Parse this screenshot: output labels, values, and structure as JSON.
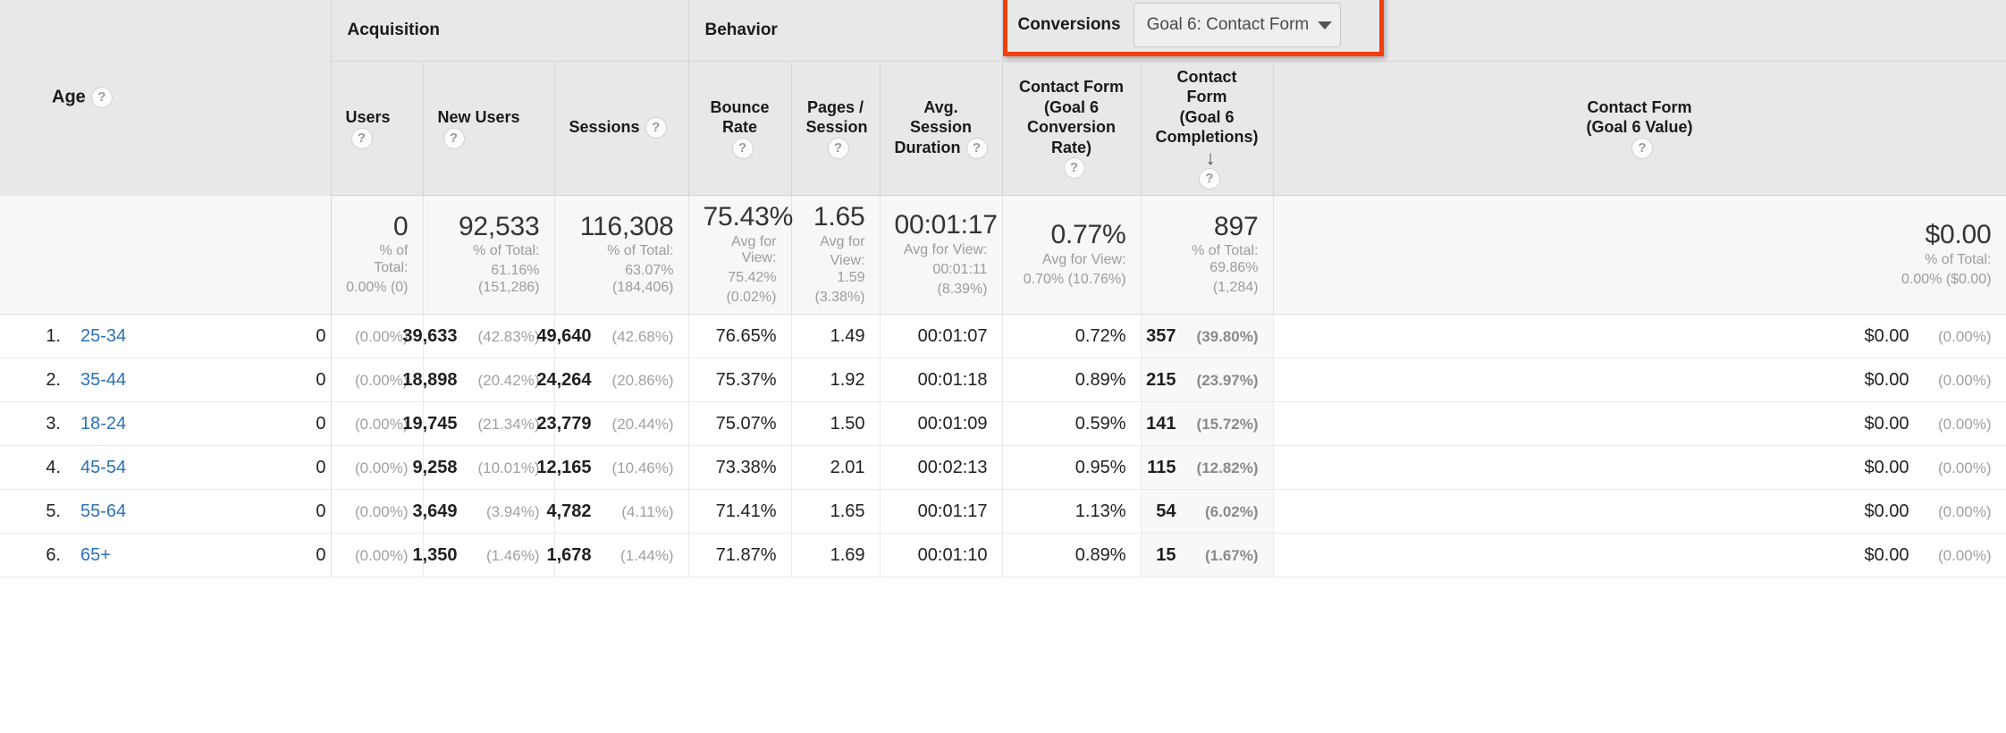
{
  "table": {
    "dimension_header": {
      "label": "Age",
      "help_icon": "question-mark-icon"
    },
    "groups": {
      "acquisition": "Acquisition",
      "behavior": "Behavior",
      "conversions": "Conversions"
    },
    "goal_selector": {
      "value": "Goal 6: Contact Form",
      "caret_icon": "chevron-down-icon"
    },
    "columns": [
      {
        "id": "users",
        "line1": "Users",
        "line2": "",
        "line3": "",
        "help": true,
        "sorted": false
      },
      {
        "id": "new_users",
        "line1": "New Users",
        "line2": "",
        "line3": "",
        "help": true,
        "sorted": false
      },
      {
        "id": "sessions",
        "line1": "Sessions",
        "line2": "",
        "line3": "",
        "help": true,
        "sorted": false
      },
      {
        "id": "bounce_rate",
        "line1": "Bounce Rate",
        "line2": "",
        "line3": "",
        "help": true,
        "sorted": false
      },
      {
        "id": "pages_session",
        "line1": "Pages /",
        "line2": "Session",
        "line3": "",
        "help": true,
        "sorted": false
      },
      {
        "id": "avg_session_duration",
        "line1": "Avg. Session",
        "line2": "Duration",
        "line3": "",
        "help": true,
        "sorted": false
      },
      {
        "id": "goal6_conversion_rate",
        "line1": "Contact Form",
        "line2": "(Goal 6",
        "line3": "Conversion Rate)",
        "help": true,
        "sorted": false
      },
      {
        "id": "goal6_completions",
        "line1": "Contact Form",
        "line2": "(Goal 6",
        "line3": "Completions)",
        "help": true,
        "sorted": true,
        "sort_icon": "sort-descending-arrow-icon"
      },
      {
        "id": "goal6_value",
        "line1": "Contact Form",
        "line2": "(Goal 6 Value)",
        "line3": "",
        "help": true,
        "sorted": false
      }
    ],
    "summary": [
      {
        "id": "users",
        "value": "0",
        "sub1": "% of Total:",
        "sub2": "0.00% (0)"
      },
      {
        "id": "new_users",
        "value": "92,533",
        "sub1": "% of Total:",
        "sub2": "61.16% (151,286)"
      },
      {
        "id": "sessions",
        "value": "116,308",
        "sub1": "% of Total:",
        "sub2": "63.07% (184,406)"
      },
      {
        "id": "bounce_rate",
        "value": "75.43%",
        "sub1": "Avg for View:",
        "sub2": "75.42%",
        "sub3": "(0.02%)"
      },
      {
        "id": "pages_session",
        "value": "1.65",
        "sub1": "Avg for",
        "sub2": "View: 1.59",
        "sub3": "(3.38%)"
      },
      {
        "id": "avg_session_duration",
        "value": "00:01:17",
        "sub1": "Avg for View:",
        "sub2": "00:01:11",
        "sub3": "(8.39%)"
      },
      {
        "id": "goal6_conversion_rate",
        "value": "0.77%",
        "sub1": "Avg for View:",
        "sub2": "0.70% (10.76%)"
      },
      {
        "id": "goal6_completions",
        "value": "897",
        "sub1": "% of Total: 69.86%",
        "sub2": "(1,284)"
      },
      {
        "id": "goal6_value",
        "value": "$0.00",
        "sub1": "% of Total:",
        "sub2": "0.00% ($0.00)"
      }
    ],
    "rows": [
      {
        "index": "1.",
        "dimension": "25-34",
        "users": "0",
        "users_pct": "(0.00%)",
        "new_users": "39,633",
        "new_users_pct": "(42.83%)",
        "sessions": "49,640",
        "sessions_pct": "(42.68%)",
        "bounce_rate": "76.65%",
        "pages_session": "1.49",
        "avg_session_duration": "00:01:07",
        "goal6_conversion_rate": "0.72%",
        "goal6_completions": "357",
        "goal6_completions_pct": "(39.80%)",
        "goal6_value": "$0.00",
        "goal6_value_pct": "(0.00%)"
      },
      {
        "index": "2.",
        "dimension": "35-44",
        "users": "0",
        "users_pct": "(0.00%)",
        "new_users": "18,898",
        "new_users_pct": "(20.42%)",
        "sessions": "24,264",
        "sessions_pct": "(20.86%)",
        "bounce_rate": "75.37%",
        "pages_session": "1.92",
        "avg_session_duration": "00:01:18",
        "goal6_conversion_rate": "0.89%",
        "goal6_completions": "215",
        "goal6_completions_pct": "(23.97%)",
        "goal6_value": "$0.00",
        "goal6_value_pct": "(0.00%)"
      },
      {
        "index": "3.",
        "dimension": "18-24",
        "users": "0",
        "users_pct": "(0.00%)",
        "new_users": "19,745",
        "new_users_pct": "(21.34%)",
        "sessions": "23,779",
        "sessions_pct": "(20.44%)",
        "bounce_rate": "75.07%",
        "pages_session": "1.50",
        "avg_session_duration": "00:01:09",
        "goal6_conversion_rate": "0.59%",
        "goal6_completions": "141",
        "goal6_completions_pct": "(15.72%)",
        "goal6_value": "$0.00",
        "goal6_value_pct": "(0.00%)"
      },
      {
        "index": "4.",
        "dimension": "45-54",
        "users": "0",
        "users_pct": "(0.00%)",
        "new_users": "9,258",
        "new_users_pct": "(10.01%)",
        "sessions": "12,165",
        "sessions_pct": "(10.46%)",
        "bounce_rate": "73.38%",
        "pages_session": "2.01",
        "avg_session_duration": "00:02:13",
        "goal6_conversion_rate": "0.95%",
        "goal6_completions": "115",
        "goal6_completions_pct": "(12.82%)",
        "goal6_value": "$0.00",
        "goal6_value_pct": "(0.00%)"
      },
      {
        "index": "5.",
        "dimension": "55-64",
        "users": "0",
        "users_pct": "(0.00%)",
        "new_users": "3,649",
        "new_users_pct": "(3.94%)",
        "sessions": "4,782",
        "sessions_pct": "(4.11%)",
        "bounce_rate": "71.41%",
        "pages_session": "1.65",
        "avg_session_duration": "00:01:17",
        "goal6_conversion_rate": "1.13%",
        "goal6_completions": "54",
        "goal6_completions_pct": "(6.02%)",
        "goal6_value": "$0.00",
        "goal6_value_pct": "(0.00%)"
      },
      {
        "index": "6.",
        "dimension": "65+",
        "users": "0",
        "users_pct": "(0.00%)",
        "new_users": "1,350",
        "new_users_pct": "(1.46%)",
        "sessions": "1,678",
        "sessions_pct": "(1.44%)",
        "bounce_rate": "71.87%",
        "pages_session": "1.69",
        "avg_session_duration": "00:01:10",
        "goal6_conversion_rate": "0.89%",
        "goal6_completions": "15",
        "goal6_completions_pct": "(1.67%)",
        "goal6_value": "$0.00",
        "goal6_value_pct": "(0.00%)"
      }
    ]
  },
  "colors": {
    "highlight_border": "#f53d09",
    "link": "#2a72b5",
    "header_bg": "#e8e8e8",
    "summary_bg": "#f7f7f7"
  }
}
